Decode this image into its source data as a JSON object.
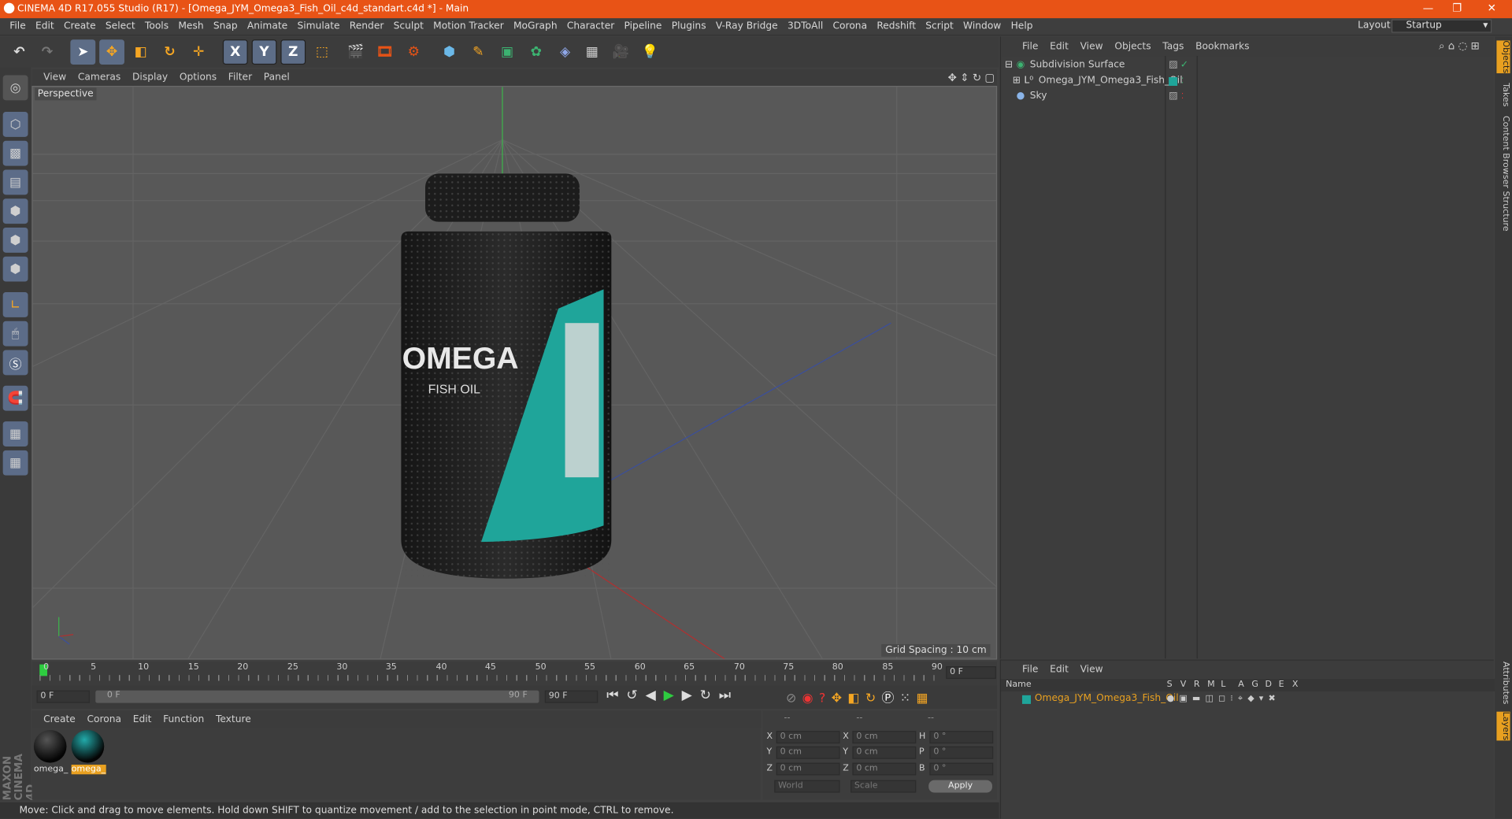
{
  "window": {
    "title": "CINEMA 4D R17.055 Studio (R17) - [Omega_JYM_Omega3_Fish_Oil_c4d_standart.c4d *] - Main",
    "min": "—",
    "restore": "❐",
    "close": "✕"
  },
  "menu": [
    "File",
    "Edit",
    "Create",
    "Select",
    "Tools",
    "Mesh",
    "Snap",
    "Animate",
    "Simulate",
    "Render",
    "Sculpt",
    "Motion Tracker",
    "MoGraph",
    "Character",
    "Pipeline",
    "Plugins",
    "V-Ray Bridge",
    "3DToAll",
    "Corona",
    "Redshift",
    "Script",
    "Window",
    "Help"
  ],
  "layout": {
    "label": "Layout:",
    "value": "Startup"
  },
  "toolbar": {
    "x": "X",
    "y": "Y",
    "z": "Z"
  },
  "viewport": {
    "menu": [
      "View",
      "Cameras",
      "Display",
      "Options",
      "Filter",
      "Panel"
    ],
    "camera": "Perspective",
    "grid_spacing": "Grid Spacing : 10 cm"
  },
  "bottle": {
    "brand": "OMEGA",
    "line1": "FISH OIL",
    "accent": "#1fa59a"
  },
  "timeline": {
    "ticks": [
      "0",
      "5",
      "10",
      "15",
      "20",
      "25",
      "30",
      "35",
      "40",
      "45",
      "50",
      "55",
      "60",
      "65",
      "70",
      "75",
      "80",
      "85",
      "90"
    ],
    "end_frame": "0 F"
  },
  "frames": {
    "start": "0 F",
    "range_start": "0 F",
    "range_end": "90 F",
    "end": "90 F"
  },
  "materials": {
    "menu": [
      "Create",
      "Corona",
      "Edit",
      "Function",
      "Texture"
    ],
    "items": [
      {
        "name": "omega_"
      },
      {
        "name": "omega_"
      }
    ]
  },
  "coords": {
    "headers": [
      "--",
      "--",
      "--"
    ],
    "rows": [
      {
        "a": "X",
        "av": "0 cm",
        "b": "X",
        "bv": "0 cm",
        "c": "H",
        "cv": "0 °"
      },
      {
        "a": "Y",
        "av": "0 cm",
        "b": "Y",
        "bv": "0 cm",
        "c": "P",
        "cv": "0 °"
      },
      {
        "a": "Z",
        "av": "0 cm",
        "b": "Z",
        "bv": "0 cm",
        "c": "B",
        "cv": "0 °"
      }
    ],
    "world": "World",
    "scale": "Scale",
    "apply": "Apply"
  },
  "status": "Move: Click and drag to move elements. Hold down SHIFT to quantize movement / add to the selection in point mode, CTRL to remove.",
  "objects": {
    "menu": [
      "File",
      "Edit",
      "View",
      "Objects",
      "Tags",
      "Bookmarks"
    ],
    "items": [
      {
        "name": "Subdivision Surface"
      },
      {
        "name": "Omega_JYM_Omega3_Fish_Oil"
      },
      {
        "name": "Sky"
      }
    ]
  },
  "layers": {
    "menu": [
      "File",
      "Edit",
      "View"
    ],
    "header": "Name",
    "cols": [
      "S",
      "V",
      "R",
      "M",
      "L",
      "A",
      "G",
      "D",
      "E",
      "X"
    ],
    "item": "Omega_JYM_Omega3_Fish_Oil"
  },
  "right_tabs": [
    "Objects",
    "Takes",
    "Content Browser",
    "Structure",
    "Attributes",
    "Layers"
  ],
  "brand": {
    "line1": "MAXON",
    "line2": "CINEMA 4D"
  }
}
